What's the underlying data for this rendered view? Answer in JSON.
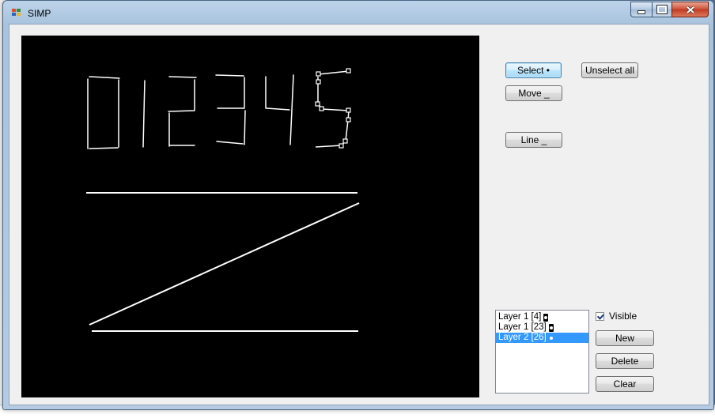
{
  "window": {
    "title": "SIMP"
  },
  "toolbar": {
    "select_label": "Select •",
    "unselect_all_label": "Unselect all",
    "move_label": "Move _",
    "line_label": "Line _"
  },
  "layers": {
    "items": [
      {
        "label": "Layer 1  [4]",
        "selected": false
      },
      {
        "label": "Layer 1  [23]",
        "selected": false
      },
      {
        "label": "Layer 2  [26]",
        "selected": true
      }
    ],
    "visible_label": "Visible",
    "visible_checked": true,
    "new_label": "New",
    "delete_label": "Delete",
    "clear_label": "Clear"
  },
  "colors": {
    "canvas_background": "#000000",
    "stroke": "#ffffff",
    "selection_highlight": "#3399ff"
  },
  "icons": {
    "app": "simp-app-icon",
    "minimize": "minimize-icon",
    "maximize": "maximize-icon",
    "close": "close-icon"
  }
}
